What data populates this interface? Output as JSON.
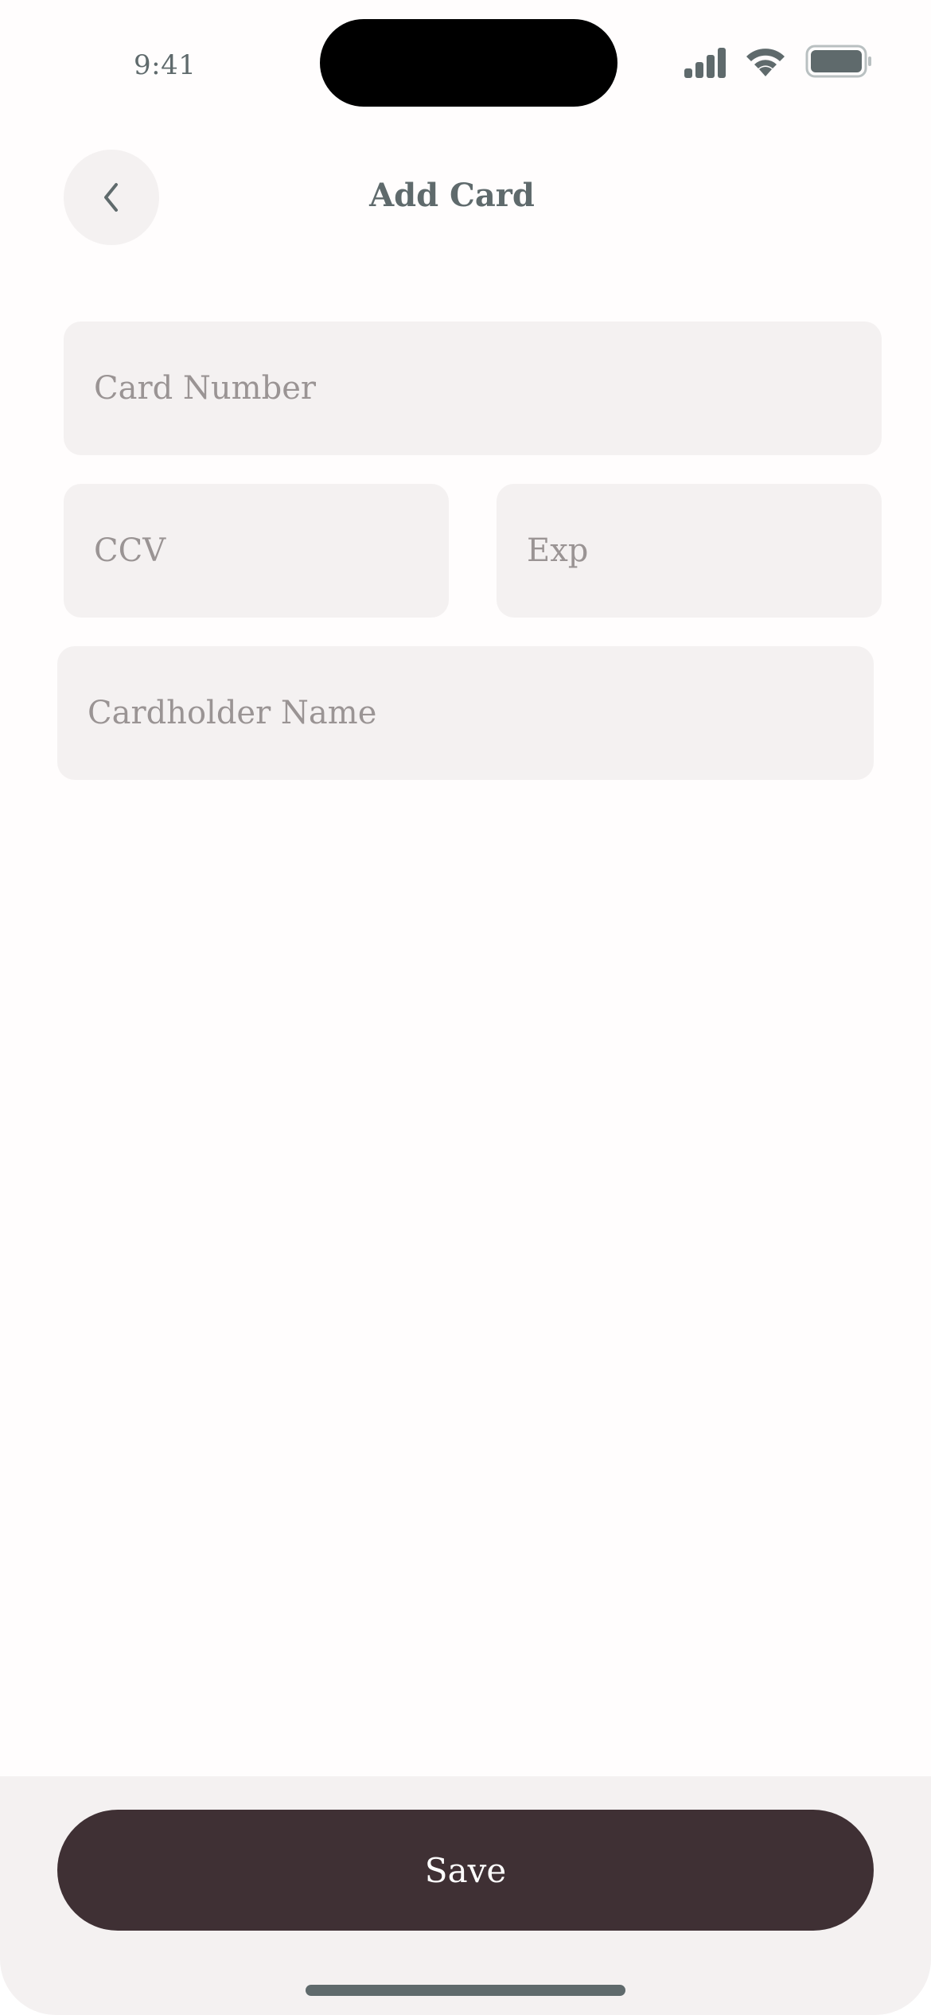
{
  "status_bar": {
    "time": "9:41",
    "icons": [
      "cellular-signal-icon",
      "wifi-icon",
      "battery-icon"
    ]
  },
  "header": {
    "back_icon": "chevron-left-icon",
    "title": "Add Card"
  },
  "form": {
    "card_number": {
      "placeholder": "Card Number",
      "value": ""
    },
    "ccv": {
      "placeholder": "CCV",
      "value": ""
    },
    "exp": {
      "placeholder": "Exp",
      "value": ""
    },
    "cardholder_name": {
      "placeholder": "Cardholder Name",
      "value": ""
    }
  },
  "footer": {
    "save_label": "Save"
  },
  "colors": {
    "background": "#fffdfd",
    "field_background": "#f4f1f1",
    "text_primary": "#5f6a6c",
    "placeholder": "#9a9494",
    "button": "#3f3034",
    "button_text": "#ffffff"
  }
}
